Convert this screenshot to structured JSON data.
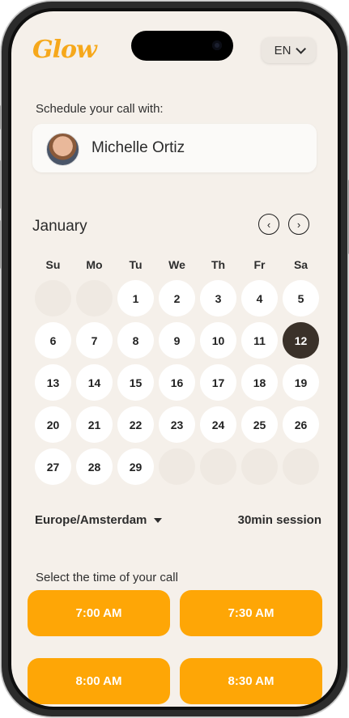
{
  "brand": {
    "logo": "Glow",
    "accent": "#fea606"
  },
  "language": {
    "selected": "EN"
  },
  "schedule": {
    "label": "Schedule your call with:",
    "host_name": "Michelle Ortiz"
  },
  "calendar": {
    "month": "January",
    "prev_icon": "chevron-left-icon",
    "next_icon": "chevron-right-icon",
    "prev_glyph": "‹",
    "next_glyph": "›",
    "weekdays": [
      "Su",
      "Mo",
      "Tu",
      "We",
      "Th",
      "Fr",
      "Sa"
    ],
    "leading_empty": 2,
    "days": [
      "1",
      "2",
      "3",
      "4",
      "5",
      "6",
      "7",
      "8",
      "9",
      "10",
      "11",
      "12",
      "13",
      "14",
      "15",
      "16",
      "17",
      "18",
      "19",
      "20",
      "21",
      "22",
      "23",
      "24",
      "25",
      "26",
      "27",
      "28",
      "29"
    ],
    "trailing_empty": 4,
    "selected_day": "12"
  },
  "timezone": {
    "value": "Europe/Amsterdam"
  },
  "session": {
    "label": "30min session"
  },
  "times": {
    "label": "Select the time of your call",
    "slots": [
      "7:00 AM",
      "7:30 AM",
      "8:00 AM",
      "8:30 AM"
    ]
  }
}
